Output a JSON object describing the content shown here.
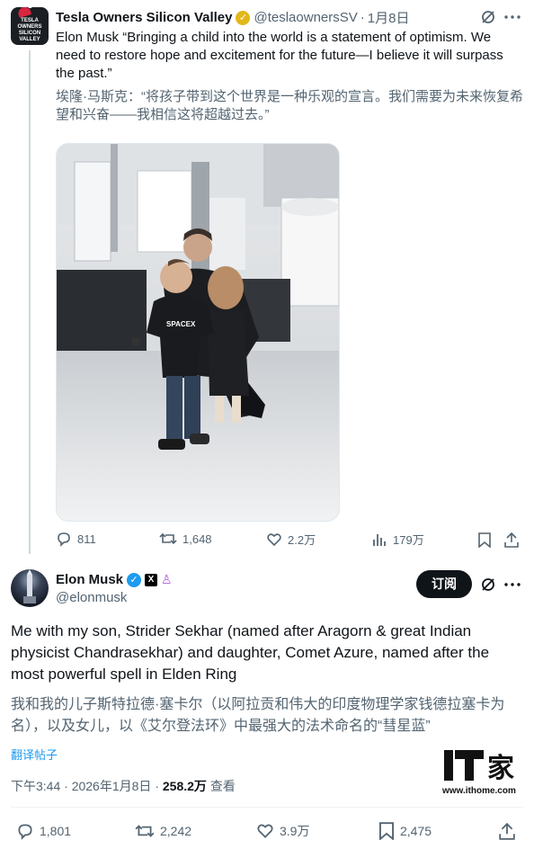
{
  "quoted_tweet": {
    "author_name": "Tesla Owners Silicon Valley",
    "avatar_text": "TESLA OWNERS SILICON VALLEY",
    "handle": "@teslaownersSV",
    "separator": "·",
    "date": "1月8日",
    "text_en": "Elon Musk “Bringing a child into the world is a statement of optimism. We need to restore hope and excitement for the future—I believe it will surpass the past.”",
    "text_zh": "埃隆·马斯克：“将孩子带到这个世界是一种乐观的宣言。我们需要为未来恢复希望和兴奋——我相信这将超越过去。”",
    "stats": {
      "replies": "811",
      "reposts": "1,648",
      "likes": "2.2万",
      "views": "179万"
    }
  },
  "main_tweet": {
    "author_name": "Elon Musk",
    "handle": "@elonmusk",
    "x_badge": "X",
    "subscribe_label": "订阅",
    "text_en": "Me with my son, Strider Sekhar (named after Aragorn & great Indian physicist Chandrasekhar) and daughter, Comet Azure, named after the most powerful spell in Elden Ring",
    "text_zh": "我和我的儿子斯特拉德·塞卡尔（以阿拉贡和伟大的印度物理学家钱德拉塞卡为名），以及女儿，以《艾尔登法环》中最强大的法术命名的“彗星蓝”",
    "translate_label": "翻译帖子",
    "time": "下午3:44",
    "dot": "·",
    "date": "2026年1月8日",
    "views_count": "258.2万",
    "views_label": "查看",
    "stats": {
      "replies": "1,801",
      "reposts": "2,242",
      "likes": "3.9万",
      "bookmarks": "2,475"
    }
  },
  "watermark": {
    "logo_text": "IT之家",
    "url": "www.ithome.com"
  },
  "colors": {
    "text": "#0f1419",
    "secondary": "#536471",
    "link": "#1d9bf0",
    "verified_blue": "#1d9bf0",
    "verified_gold": "#e2b719"
  }
}
